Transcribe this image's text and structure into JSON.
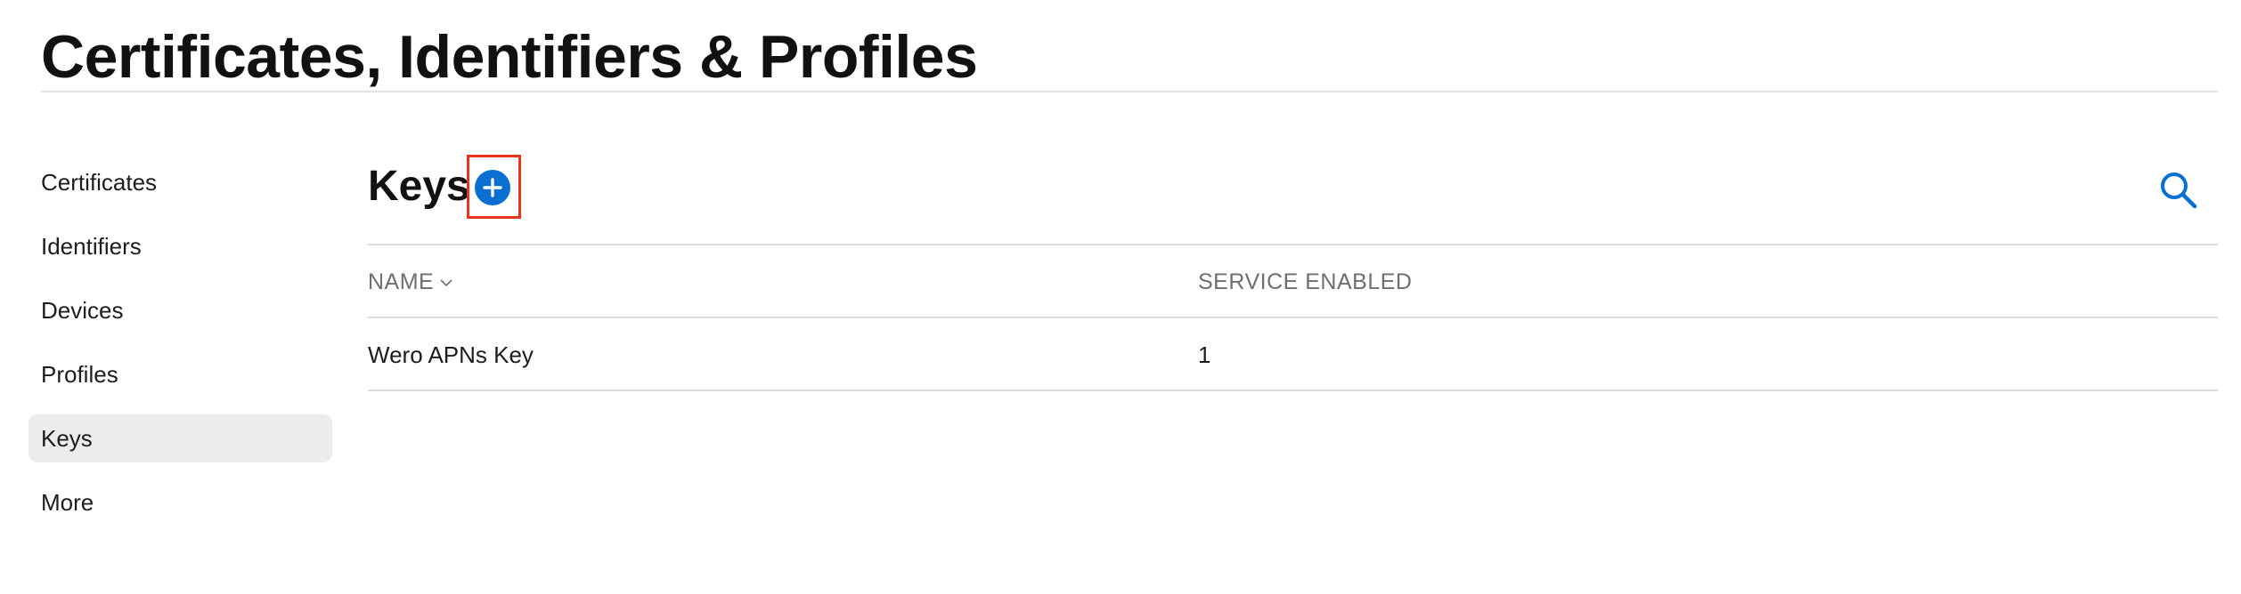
{
  "header": {
    "title": "Certificates, Identifiers & Profiles"
  },
  "sidebar": {
    "items": [
      {
        "label": "Certificates",
        "active": false
      },
      {
        "label": "Identifiers",
        "active": false
      },
      {
        "label": "Devices",
        "active": false
      },
      {
        "label": "Profiles",
        "active": false
      },
      {
        "label": "Keys",
        "active": true
      },
      {
        "label": "More",
        "active": false
      }
    ]
  },
  "main": {
    "heading": "Keys",
    "add_icon": "plus-circle-icon",
    "search_icon": "search-icon",
    "accent_color": "#0a6fd1",
    "highlight_color": "#e8341c",
    "table": {
      "columns": [
        "NAME",
        "SERVICE ENABLED"
      ],
      "sort_column": "NAME",
      "sort_icon": "chevron-down-icon",
      "rows": [
        {
          "name": "Wero APNs Key",
          "service_enabled": "1"
        }
      ]
    }
  }
}
